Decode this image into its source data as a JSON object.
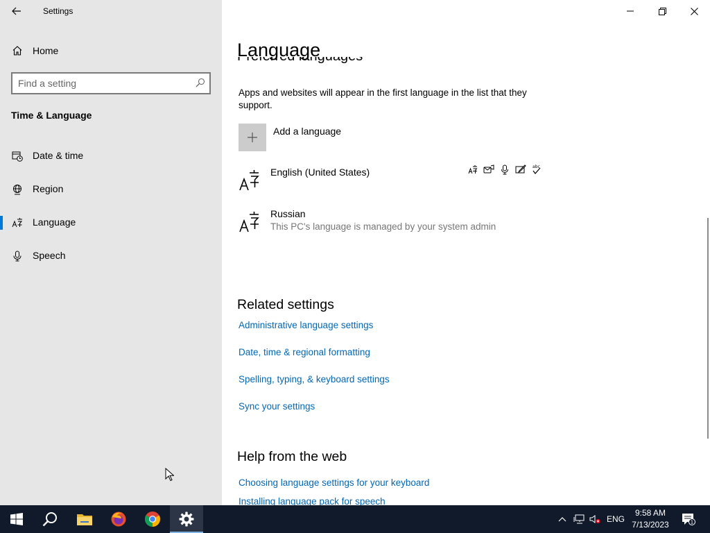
{
  "window": {
    "title": "Settings",
    "controls": [
      "minimize",
      "restore",
      "close"
    ]
  },
  "sidebar": {
    "home_label": "Home",
    "search_placeholder": "Find a setting",
    "section_title": "Time & Language",
    "items": [
      {
        "label": "Date & time",
        "icon": "calendar-clock-icon",
        "active": false
      },
      {
        "label": "Region",
        "icon": "globe-icon",
        "active": false
      },
      {
        "label": "Language",
        "icon": "language-icon",
        "active": true
      },
      {
        "label": "Speech",
        "icon": "microphone-icon",
        "active": false
      }
    ]
  },
  "main": {
    "page_title": "Language",
    "partial_heading": "Preferred languages",
    "description": "Apps and websites will appear in the first language in the list that they support.",
    "add_language_label": "Add a language",
    "languages": [
      {
        "name": "English (United States)",
        "subtitle": ""
      },
      {
        "name": "Russian",
        "subtitle": "This PC's language is managed by your system admin"
      }
    ],
    "feature_icons": [
      "language-pack-icon",
      "text-to-speech-icon",
      "speech-recognition-icon",
      "handwriting-icon",
      "spelling-icon"
    ],
    "related": {
      "heading": "Related settings",
      "links": [
        "Administrative language settings",
        "Date, time & regional formatting",
        "Spelling, typing, & keyboard settings",
        "Sync your settings"
      ]
    },
    "help": {
      "heading": "Help from the web",
      "links": [
        "Choosing language settings for your keyboard",
        "Installing language pack for speech"
      ]
    }
  },
  "taskbar": {
    "apps": [
      "start-icon",
      "search-icon",
      "file-explorer-icon",
      "firefox-icon",
      "chrome-icon",
      "settings-icon"
    ],
    "language_indicator": "ENG",
    "time": "9:58 AM",
    "date": "7/13/2023",
    "notification_count": "1"
  },
  "colors": {
    "accent": "#0078d7",
    "link": "#0067b8",
    "sidebar_bg": "#e6e6e6",
    "taskbar_bg": "#101a2a"
  }
}
